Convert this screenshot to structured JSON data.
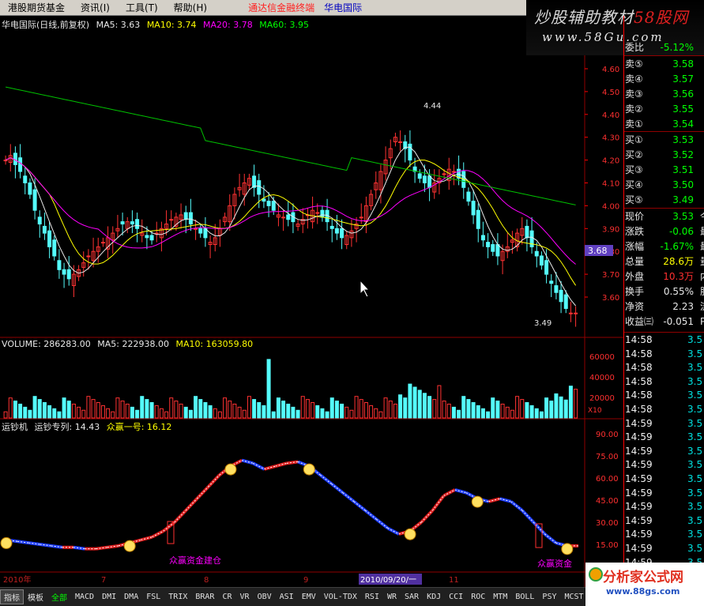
{
  "menu": {
    "items": [
      "港股期货基金",
      "资讯",
      "工具",
      "帮助"
    ],
    "hotkeys": [
      "",
      "(I)",
      "(T)",
      "(H)"
    ],
    "brand": "通达信金融终端",
    "stock": "华电国际"
  },
  "watermark_top": {
    "line1_a": "炒股辅助教材",
    "line1_b": "58股网",
    "line2": "www.58Gu.com"
  },
  "main_legend": {
    "title": "华电国际(日线,前复权)",
    "items": [
      {
        "label": "MA5: 3.63",
        "color": "#e8e8e8"
      },
      {
        "label": "MA10: 3.74",
        "color": "#ffff00"
      },
      {
        "label": "MA20: 3.78",
        "color": "#ff00ff"
      },
      {
        "label": "MA60: 3.95",
        "color": "#00ff00"
      }
    ]
  },
  "price_axis": [
    "4.60",
    "4.50",
    "4.40",
    "4.30",
    "4.20",
    "4.10",
    "4.00",
    "3.90",
    "3.80",
    "3.70",
    "3.60"
  ],
  "annotations": {
    "high": "4.44",
    "low": "3.49",
    "current": "3.68"
  },
  "volume_legend": {
    "items": [
      {
        "label": "VOLUME: 286283.00",
        "color": "#e8e8e8"
      },
      {
        "label": "MA5: 222938.00",
        "color": "#e8e8e8"
      },
      {
        "label": "MA10: 163059.80",
        "color": "#ffff00"
      }
    ]
  },
  "volume_axis": [
    "60000",
    "40000",
    "20000"
  ],
  "volume_unit": "X10",
  "indicator_legend": {
    "items": [
      {
        "label": "运钞机",
        "color": "#e8e8e8"
      },
      {
        "label": "运钞专列: 14.43",
        "color": "#e8e8e8"
      },
      {
        "label": "众赢一号: 16.12",
        "color": "#ffff00"
      }
    ]
  },
  "indicator_axis": [
    "90.00",
    "75.00",
    "60.00",
    "45.00",
    "30.00",
    "15.00"
  ],
  "indicator_notes": [
    "众赢资金建仓",
    "众赢资金"
  ],
  "time_axis": {
    "labels": [
      "2010年",
      "7",
      "8",
      "9",
      "11"
    ],
    "cursor": "2010/09/20/一"
  },
  "quote": {
    "top_label": "委比",
    "top_value": "-5.12%",
    "asks": [
      {
        "label": "卖⑤",
        "price": "3.58"
      },
      {
        "label": "卖④",
        "price": "3.57"
      },
      {
        "label": "卖③",
        "price": "3.56"
      },
      {
        "label": "卖②",
        "price": "3.55"
      },
      {
        "label": "卖①",
        "price": "3.54"
      }
    ],
    "bids": [
      {
        "label": "买①",
        "price": "3.53"
      },
      {
        "label": "买②",
        "price": "3.52"
      },
      {
        "label": "买③",
        "price": "3.51"
      },
      {
        "label": "买④",
        "price": "3.50"
      },
      {
        "label": "买⑤",
        "price": "3.49"
      }
    ],
    "stats": [
      {
        "label": "现价",
        "value": "3.53",
        "tail": "今",
        "color": "#00ff00"
      },
      {
        "label": "涨跌",
        "value": "-0.06",
        "tail": "最",
        "color": "#00ff00"
      },
      {
        "label": "涨幅",
        "value": "-1.67%",
        "tail": "最",
        "color": "#00ff00"
      },
      {
        "label": "总量",
        "value": "28.6万",
        "tail": "量",
        "color": "#ffff00"
      },
      {
        "label": "外盘",
        "value": "10.3万",
        "tail": "内",
        "color": "#ff3030"
      },
      {
        "label": "换手",
        "value": "0.55%",
        "tail": "股",
        "color": "#e8e8e8"
      },
      {
        "label": "净资",
        "value": "2.23",
        "tail": "流",
        "color": "#e8e8e8"
      },
      {
        "label": "收益㈢",
        "value": "-0.051",
        "tail": "P",
        "color": "#e8e8e8"
      }
    ]
  },
  "ticks": [
    {
      "time": "14:58",
      "price": "3.5"
    },
    {
      "time": "14:58",
      "price": "3.5"
    },
    {
      "time": "14:58",
      "price": "3.5"
    },
    {
      "time": "14:58",
      "price": "3.5"
    },
    {
      "time": "14:58",
      "price": "3.5"
    },
    {
      "time": "14:58",
      "price": "3.5"
    },
    {
      "time": "14:59",
      "price": "3.5"
    },
    {
      "time": "14:59",
      "price": "3.5"
    },
    {
      "time": "14:59",
      "price": "3.5"
    },
    {
      "time": "14:59",
      "price": "3.5"
    },
    {
      "time": "14:59",
      "price": "3.5"
    },
    {
      "time": "14:59",
      "price": "3.5"
    },
    {
      "time": "14:59",
      "price": "3.5"
    },
    {
      "time": "14:59",
      "price": "3.5"
    },
    {
      "time": "14:59",
      "price": "3.5"
    },
    {
      "time": "14:59",
      "price": "3.5"
    },
    {
      "time": "14:59",
      "price": "3.5"
    }
  ],
  "tabs": [
    "指标",
    "模板",
    "全部",
    "MACD",
    "DMI",
    "DMA",
    "FSL",
    "TRIX",
    "BRAR",
    "CR",
    "VR",
    "OBV",
    "ASI",
    "EMV",
    "VOL-TDX",
    "RSI",
    "WR",
    "SAR",
    "KDJ",
    "CCI",
    "ROC",
    "MTM",
    "BOLL",
    "PSY",
    "MCST"
  ],
  "watermark_bottom": {
    "line1": "分析家公式网",
    "line2": "www.88gs.com"
  },
  "colors": {
    "up": "#ff3232",
    "down": "#54fcfc",
    "grid": "#900000",
    "ma5": "#e8e8e8",
    "ma10": "#ffff00",
    "ma20": "#ff00ff",
    "ma60": "#00c000"
  }
}
